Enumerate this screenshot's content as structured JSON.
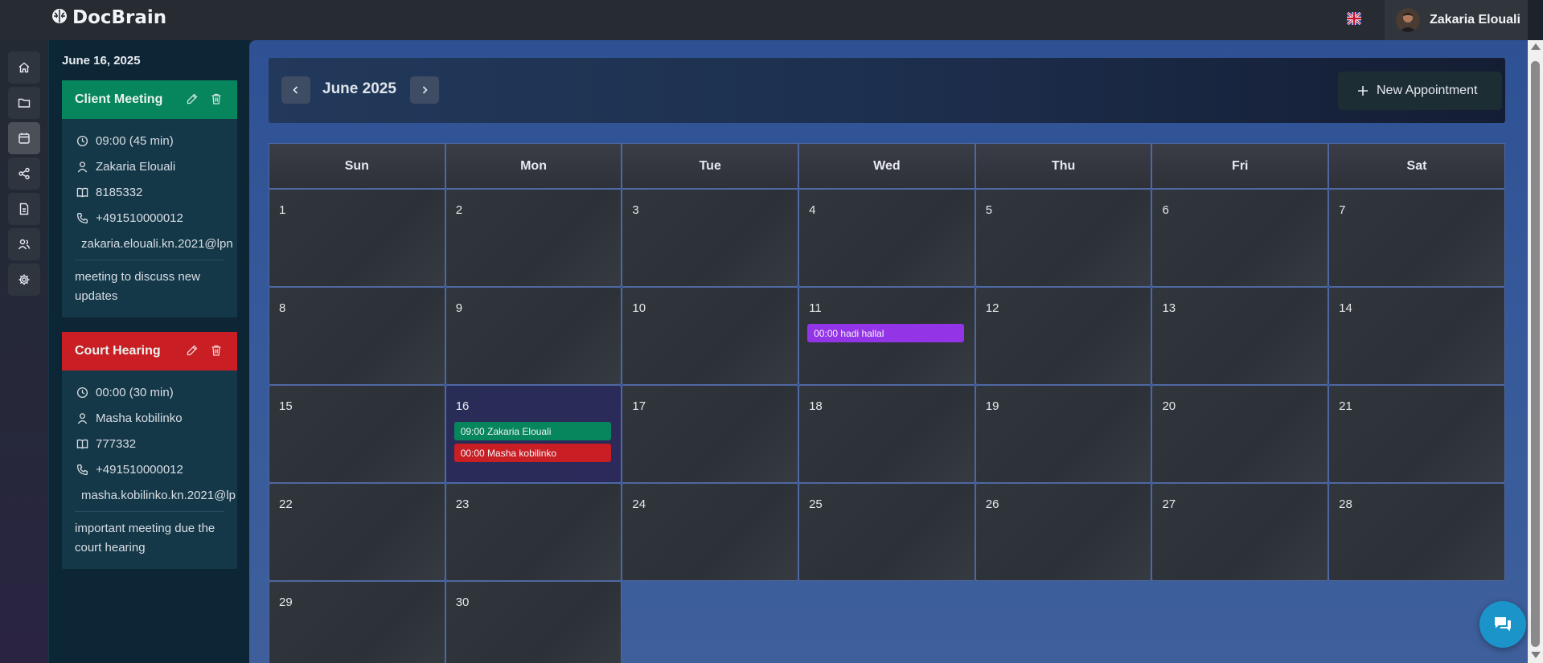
{
  "app": {
    "name": "DocBrain"
  },
  "user": {
    "name": "Zakaria Elouali"
  },
  "agenda": {
    "date": "June 16, 2025",
    "appointments": [
      {
        "title": "Client Meeting",
        "color": "#07865d",
        "time": "09:00 (45 min)",
        "person": "Zakaria Elouali",
        "case_number": "8185332",
        "phone": "+491510000012",
        "email": "zakaria.elouali.kn.2021@lpn",
        "note": "meeting to discuss new updates"
      },
      {
        "title": "Court Hearing",
        "color": "#c81e24",
        "time": "00:00 (30 min)",
        "person": "Masha kobilinko",
        "case_number": "777332",
        "phone": "+491510000012",
        "email": "masha.kobilinko.kn.2021@lp",
        "note": "important meeting due the court hearing"
      }
    ]
  },
  "calendar": {
    "month_label": "June 2025",
    "new_appointment_label": "New Appointment",
    "weekdays": [
      "Sun",
      "Mon",
      "Tue",
      "Wed",
      "Thu",
      "Fri",
      "Sat"
    ],
    "weeks": [
      [
        "1",
        "2",
        "3",
        "4",
        "5",
        "6",
        "7"
      ],
      [
        "8",
        "9",
        "10",
        "11",
        "12",
        "13",
        "14"
      ],
      [
        "15",
        "16",
        "17",
        "18",
        "19",
        "20",
        "21"
      ],
      [
        "22",
        "23",
        "24",
        "25",
        "26",
        "27",
        "28"
      ],
      [
        "29",
        "30"
      ]
    ],
    "today": "16",
    "events": [
      {
        "day": "11",
        "label": "00:00 hadi hallal",
        "color": "#9334e6"
      },
      {
        "day": "16",
        "label": "09:00 Zakaria Elouali",
        "color": "#07865d"
      },
      {
        "day": "16",
        "label": "00:00 Masha kobilinko",
        "color": "#c81e24"
      }
    ]
  },
  "sidebar": {
    "items": [
      {
        "name": "home-icon",
        "active": false
      },
      {
        "name": "folder-icon",
        "active": false
      },
      {
        "name": "calendar-icon",
        "active": true
      },
      {
        "name": "share-icon",
        "active": false
      },
      {
        "name": "document-icon",
        "active": false
      },
      {
        "name": "users-icon",
        "active": false
      },
      {
        "name": "gear-icon",
        "active": false
      }
    ]
  },
  "icons": {
    "chat": "chat-icon",
    "language": "uk-flag-icon",
    "logo": "brain-icon"
  }
}
